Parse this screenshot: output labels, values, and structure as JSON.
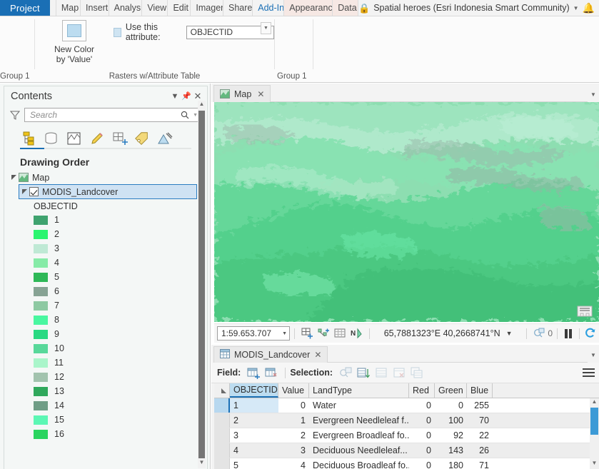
{
  "ribbon": {
    "project_tab": "Project",
    "tabs": [
      {
        "label": "Map",
        "state": "normal"
      },
      {
        "label": "Insert",
        "state": "normal"
      },
      {
        "label": "Analysi",
        "state": "normal"
      },
      {
        "label": "View",
        "state": "normal"
      },
      {
        "label": "Edit",
        "state": "normal"
      },
      {
        "label": "Imager",
        "state": "normal"
      },
      {
        "label": "Share",
        "state": "normal"
      },
      {
        "label": "Add-In",
        "state": "active"
      },
      {
        "label": "Appearance",
        "state": "contextual"
      },
      {
        "label": "Data",
        "state": "contextual"
      }
    ],
    "project_title": "Spatial heroes (Esri Indonesia Smart Community)",
    "groups": {
      "left_label": "Group 1",
      "raster_label": "Rasters w/Attribute Table",
      "right_label": "Group 1"
    },
    "new_color_button": {
      "line1": "New Color",
      "line2": "by 'Value'"
    },
    "use_attribute": {
      "label": "Use this attribute:",
      "value": "OBJECTID"
    }
  },
  "contents": {
    "title": "Contents",
    "search_placeholder": "Search",
    "section_title": "Drawing Order",
    "map_node": "Map",
    "layer_node": "MODIS_Landcover",
    "field_node": "OBJECTID",
    "legend": [
      {
        "label": "1",
        "color": "#3fa36f"
      },
      {
        "label": "2",
        "color": "#2bf56f"
      },
      {
        "label": "3",
        "color": "#bfe9d5"
      },
      {
        "label": "4",
        "color": "#86eba7"
      },
      {
        "label": "5",
        "color": "#2eb857"
      },
      {
        "label": "6",
        "color": "#87a394"
      },
      {
        "label": "7",
        "color": "#8dc9a2"
      },
      {
        "label": "8",
        "color": "#49f7a0"
      },
      {
        "label": "9",
        "color": "#29d982"
      },
      {
        "label": "10",
        "color": "#58d89a"
      },
      {
        "label": "11",
        "color": "#a9f5ca"
      },
      {
        "label": "12",
        "color": "#a2c3ae"
      },
      {
        "label": "13",
        "color": "#30a85c"
      },
      {
        "label": "14",
        "color": "#6f9d86"
      },
      {
        "label": "15",
        "color": "#5cf7b4"
      },
      {
        "label": "16",
        "color": "#2ad45f"
      }
    ]
  },
  "mapview": {
    "tab_label": "Map",
    "scale": "1:59.653.707",
    "coordinates": "65,7881323°E 40,2668741°N",
    "selection_count": "0"
  },
  "table": {
    "tab_label": "MODIS_Landcover",
    "field_label": "Field:",
    "selection_label": "Selection:",
    "columns": [
      "OBJECTID",
      "Value",
      "LandType",
      "Red",
      "Green",
      "Blue"
    ],
    "rows": [
      {
        "OBJECTID": "1",
        "Value": "0",
        "LandType": "Water",
        "Red": "0",
        "Green": "0",
        "Blue": "255",
        "selected": true
      },
      {
        "OBJECTID": "2",
        "Value": "1",
        "LandType": "Evergreen Needleleaf f...",
        "Red": "0",
        "Green": "100",
        "Blue": "70",
        "selected": false
      },
      {
        "OBJECTID": "3",
        "Value": "2",
        "LandType": "Evergreen Broadleaf fo...",
        "Red": "0",
        "Green": "92",
        "Blue": "22",
        "selected": false
      },
      {
        "OBJECTID": "4",
        "Value": "3",
        "LandType": "Deciduous Needleleaf...",
        "Red": "0",
        "Green": "143",
        "Blue": "26",
        "selected": false
      },
      {
        "OBJECTID": "5",
        "Value": "4",
        "LandType": "Deciduous Broadleaf fo...",
        "Red": "0",
        "Green": "180",
        "Blue": "71",
        "selected": false
      }
    ]
  },
  "colors": {
    "accent": "#1a6fb5",
    "ribbon_bg": "#fbfbfb",
    "contextual_tab": "#f6e8e4",
    "selection_blue": "#cfe2f3"
  }
}
